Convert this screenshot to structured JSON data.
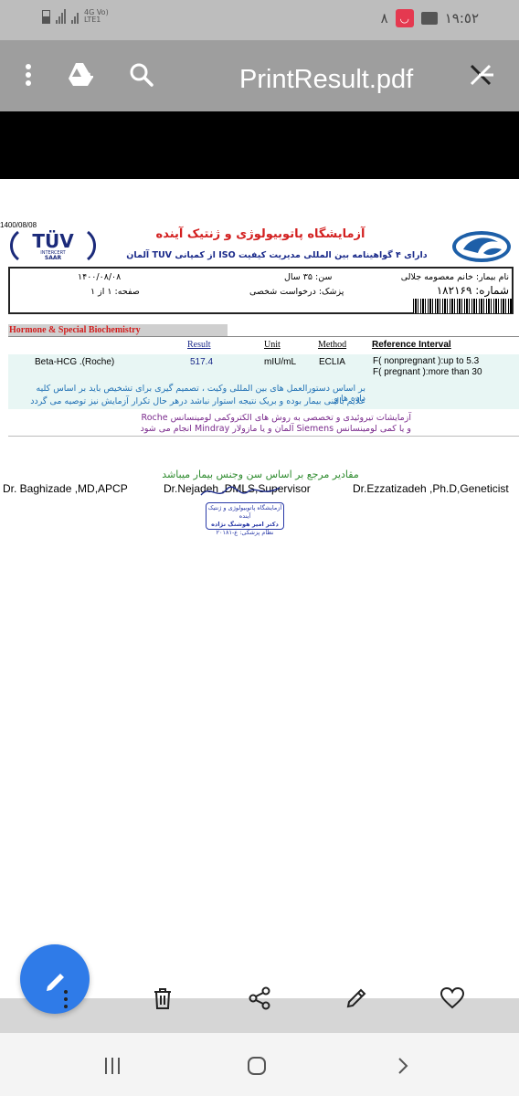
{
  "status_bar": {
    "network": "4G Vo) LTE1",
    "notification_count": "٨",
    "time": "١٩:٥٢"
  },
  "toolbar": {
    "title": "PrintResult.pdf",
    "icons": [
      "more-vert-icon",
      "drive-add-icon",
      "search-icon",
      "close-edit-icon"
    ]
  },
  "document": {
    "print_date": "1400/08/08",
    "tuv_logo": {
      "brand": "TÜV",
      "line1": "INTERCERT",
      "line2": "SAAR"
    },
    "lab_title": "آزمایشگاه پاتوبیولوژی و ژنتیک آینده",
    "lab_subtitle": "دارای ۴ گواهینامه بین المللی مدیریت کیفیت ISO از کمپانی TUV آلمان",
    "patient": {
      "name": "نام بیمار: خانم معصومه جلالی",
      "age": "سن: ۳۵ سال",
      "date": "۱۴۰۰/۰۸/۰۸",
      "doctor": "پزشک: درخواست شخصی",
      "page": "صفحه: ۱ از ۱",
      "number": "شماره: ۱۸۲۱۶۹"
    },
    "section_title": "Hormone & Special Biochemistry",
    "columns": {
      "result": "Result",
      "unit": "Unit",
      "method": "Method",
      "reference": "Reference Interval"
    },
    "row": {
      "test": "Beta-HCG .(Roche)",
      "result": "517.4",
      "unit": "mIU/mL",
      "method": "ECLIA",
      "ref_line1": "F( nonpregnant ):up to 5.3",
      "ref_line2": "F( pregnant ):more than 30"
    },
    "note_teal_1": "بر اساس دستورالعمل های بین المللی وکیت ، تصمیم گیری برای تشخیص باید بر اساس کلیه داده ها و",
    "note_teal_2": "علایم بالینی بیمار بوده و بریک نتیجه استوار نباشد درهر حال تکرار آزمایش نیز توصیه می گردد",
    "note_purple_1": "آزمایشات تیروئیدی و تخصصی به روش های الکتروکمی لومینسانس Roche",
    "note_purple_2": "و یا کمی لومینسانس Siemens آلمان و یا مازولار Mindray انجام می شود"
  },
  "footer": {
    "green_note": "مقادیر مرجع بر اساس سن وجنس بیمار میباشد",
    "signatures": [
      "Dr. Baghizade ,MD,APCP",
      "Dr.Nejadeh ,DMLS,Supervisor",
      "Dr.Ezzatizadeh ,Ph.D,Geneticist"
    ],
    "stamp_line1": "آزمایشگاه پاتوبیولوژی و ژنتیک آینده",
    "stamp_line2": "دکتر امیر هوشنگ نژاده",
    "stamp_line3": "نظام پزشکی: ع-۲۰۱۸۱"
  },
  "bottom_actions": [
    "edit-fab-icon",
    "more-vert-icon",
    "delete-icon",
    "share-icon",
    "pen-icon",
    "favorite-icon"
  ],
  "nav": [
    "recents-icon",
    "home-icon",
    "back-icon"
  ],
  "colors": {
    "fab": "#2f7be8",
    "toolbar": "#9e9e9e",
    "status": "#bdbdbd",
    "lab_title": "#d32020"
  }
}
